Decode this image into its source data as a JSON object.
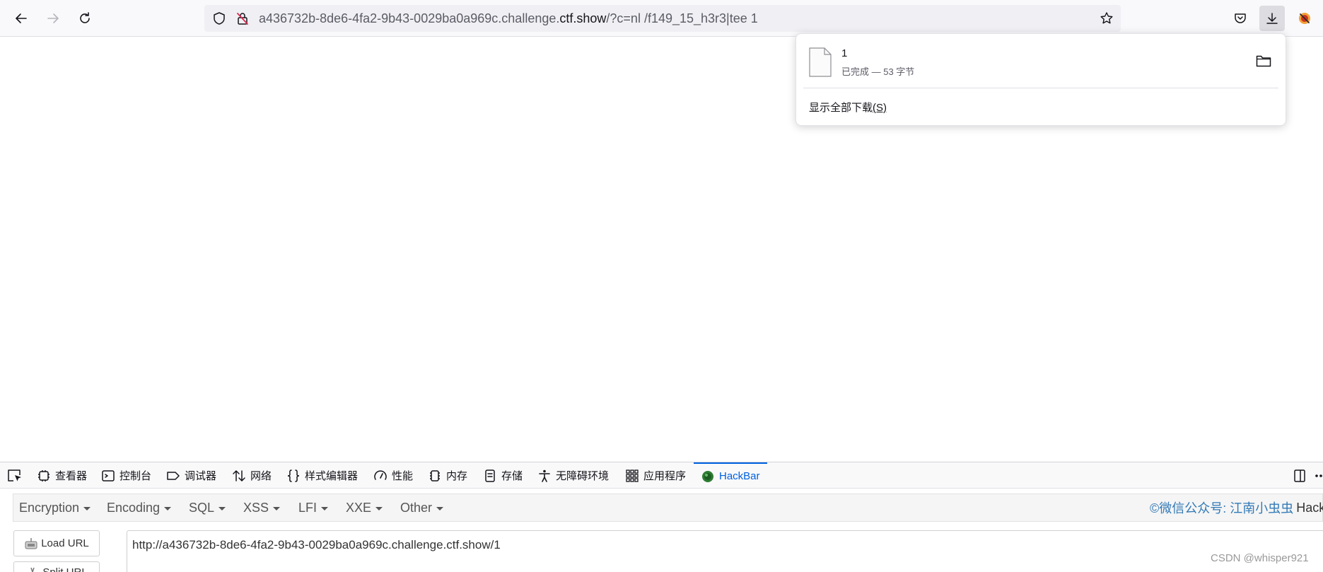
{
  "browser": {
    "url": {
      "prefix": "a436732b-8de6-4fa2-9b43-0029ba0a969c.challenge.",
      "host": "ctf.show",
      "suffix": "/?c=nl /f149_15_h3r3|tee 1"
    }
  },
  "downloads": {
    "file_name": "1",
    "status": "已完成 — 53 字节",
    "show_all_label": "显示全部下载",
    "show_all_accesskey": "(S)"
  },
  "devtools": {
    "tabs": [
      {
        "label": "查看器",
        "icon": "inspector-icon"
      },
      {
        "label": "控制台",
        "icon": "console-icon"
      },
      {
        "label": "调试器",
        "icon": "debugger-icon"
      },
      {
        "label": "网络",
        "icon": "network-icon"
      },
      {
        "label": "样式编辑器",
        "icon": "style-editor-icon"
      },
      {
        "label": "性能",
        "icon": "performance-icon"
      },
      {
        "label": "内存",
        "icon": "memory-icon"
      },
      {
        "label": "存储",
        "icon": "storage-icon"
      },
      {
        "label": "无障碍环境",
        "icon": "accessibility-icon"
      },
      {
        "label": "应用程序",
        "icon": "application-icon"
      },
      {
        "label": "HackBar",
        "icon": "hackbar-icon",
        "active": true
      }
    ],
    "accent": "#0061e0"
  },
  "hackbar": {
    "menus": [
      "Encryption",
      "Encoding",
      "SQL",
      "XSS",
      "LFI",
      "XXE",
      "Other"
    ],
    "credit_link": "©微信公众号: 江南小虫虫",
    "credit_text": "HackBa",
    "load_url_label": "Load URL",
    "split_url_label": "Split URL",
    "url_value": "http://a436732b-8de6-4fa2-9b43-0029ba0a969c.challenge.ctf.show/1",
    "link_color": "#337ab7"
  },
  "watermark": "CSDN @whisper921"
}
